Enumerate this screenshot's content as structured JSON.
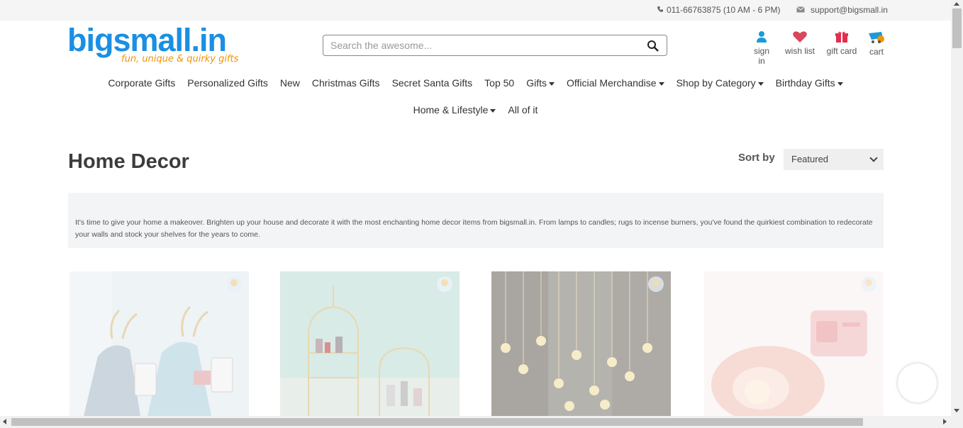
{
  "topbar": {
    "phone": "011-66763875 (10 AM - 6 PM)",
    "email": "support@bigsmall.in"
  },
  "logo": {
    "name": "bigsmall.in",
    "tagline": "fun, unique & quirky gifts"
  },
  "search": {
    "placeholder": "Search the awesome..."
  },
  "header_icons": {
    "sign_in": "sign in",
    "wish_list": "wish list",
    "gift_card": "gift card",
    "cart": "cart"
  },
  "nav": {
    "row1": [
      {
        "label": "Corporate Gifts",
        "dropdown": false
      },
      {
        "label": "Personalized Gifts",
        "dropdown": false
      },
      {
        "label": "New",
        "dropdown": false
      },
      {
        "label": "Christmas Gifts",
        "dropdown": false
      },
      {
        "label": "Secret Santa Gifts",
        "dropdown": false
      },
      {
        "label": "Top 50",
        "dropdown": false
      },
      {
        "label": "Gifts",
        "dropdown": true
      },
      {
        "label": "Official Merchandise",
        "dropdown": true
      },
      {
        "label": "Shop by Category",
        "dropdown": true
      },
      {
        "label": "Birthday Gifts",
        "dropdown": true
      }
    ],
    "row2": [
      {
        "label": "Home & Lifestyle",
        "dropdown": true
      },
      {
        "label": "All of it",
        "dropdown": false
      }
    ]
  },
  "page": {
    "title": "Home Decor",
    "sort_label": "Sort by",
    "sort_value": "Featured",
    "description": "It's time to give your home a makeover. Brighten up your house and decorate it with the most enchanting home decor items from bigsmall.in. From lamps to candles; rugs to incense burners, you've found the quirkiest combination to redecorate your walls and stock your shelves for the years to come."
  },
  "products": [
    {
      "image": "deer-phone-holders"
    },
    {
      "image": "birdcage-shelf"
    },
    {
      "image": "bulb-string-lights"
    },
    {
      "image": "shell-lamp"
    }
  ],
  "colors": {
    "brand_blue": "#1a8fe3",
    "brand_orange": "#f29400",
    "accent_teal": "#1a9bd7",
    "wish_red": "#d9475b",
    "gift_red": "#e0304d"
  }
}
